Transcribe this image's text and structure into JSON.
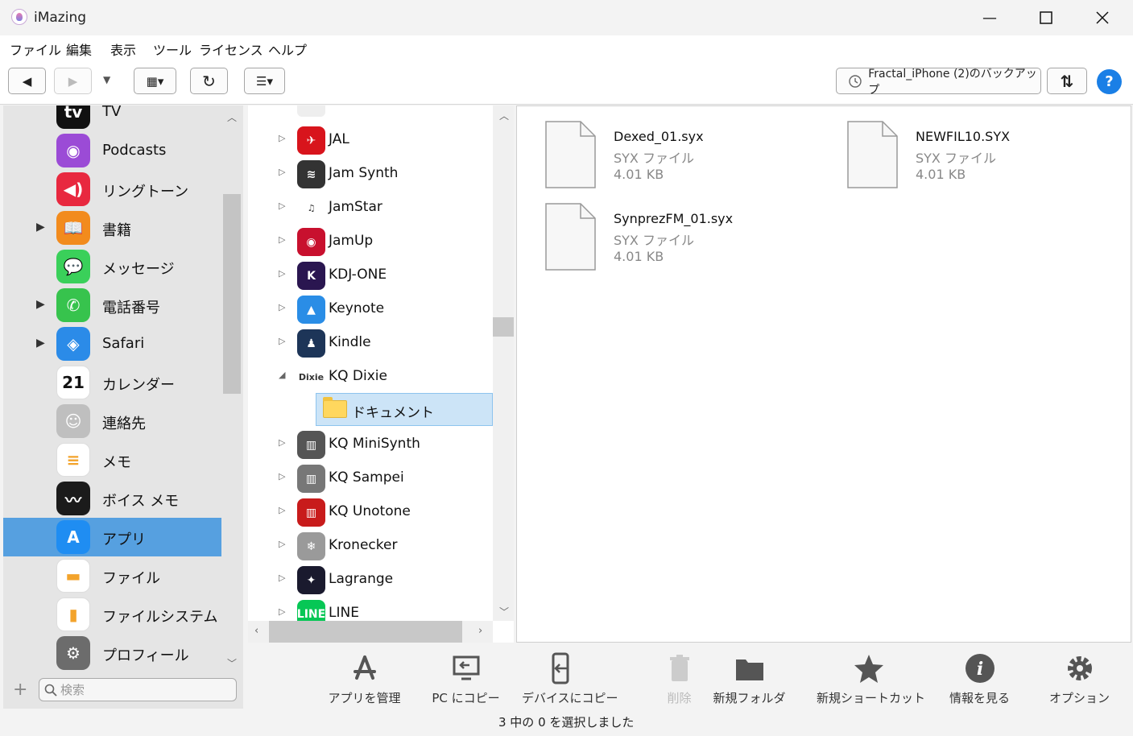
{
  "window": {
    "title": "iMazing",
    "minimize": "—",
    "maximize": "☐",
    "close": "✕"
  },
  "menu": [
    "ファイル",
    "編集",
    "表示",
    "ツール",
    "ライセンス",
    "ヘルプ"
  ],
  "toolbar": {
    "back": "◀",
    "forward": "▶",
    "dropdown": "▼",
    "view": "▦▾",
    "refresh": "↻",
    "list": "☰▾",
    "backup_label": "Fractal_iPhone (2)のバックアップ",
    "help": "?",
    "transfer": "⇅"
  },
  "sidebar": {
    "items": [
      {
        "label": "TV",
        "icon": "tv-icon",
        "color": "#111111",
        "glyph": "tv",
        "arrow": ""
      },
      {
        "label": "Podcasts",
        "icon": "podcasts-icon",
        "color": "#9b4bd6",
        "glyph": "◉",
        "arrow": ""
      },
      {
        "label": "リングトーン",
        "icon": "ringtone-icon",
        "color": "#e8283f",
        "glyph": "◀)",
        "arrow": ""
      },
      {
        "label": "書籍",
        "icon": "books-icon",
        "color": "#f28b1d",
        "glyph": "📖",
        "arrow": "▶"
      },
      {
        "label": "メッセージ",
        "icon": "messages-icon",
        "color": "#3ad05a",
        "glyph": "💬",
        "arrow": ""
      },
      {
        "label": "電話番号",
        "icon": "phone-icon",
        "color": "#37c34d",
        "glyph": "✆",
        "arrow": "▶"
      },
      {
        "label": "Safari",
        "icon": "safari-icon",
        "color": "#2b8be8",
        "glyph": "◈",
        "arrow": "▶"
      },
      {
        "label": "カレンダー",
        "icon": "calendar-icon",
        "color": "#ffffff",
        "glyph": "21",
        "arrow": ""
      },
      {
        "label": "連絡先",
        "icon": "contacts-icon",
        "color": "#bfbfbf",
        "glyph": "☺",
        "arrow": ""
      },
      {
        "label": "メモ",
        "icon": "notes-icon",
        "color": "#ffffff",
        "glyph": "≡",
        "arrow": ""
      },
      {
        "label": "ボイス メモ",
        "icon": "voice-memo-icon",
        "color": "#1b1b1b",
        "glyph": "〰",
        "arrow": ""
      },
      {
        "label": "アプリ",
        "icon": "appstore-icon",
        "color": "#1f8df2",
        "glyph": "A",
        "arrow": ""
      },
      {
        "label": "ファイル",
        "icon": "files-icon",
        "color": "#ffffff",
        "glyph": "▬",
        "arrow": ""
      },
      {
        "label": "ファイルシステム",
        "icon": "filesystem-icon",
        "color": "#ffffff",
        "glyph": "▮",
        "arrow": ""
      },
      {
        "label": "プロフィール",
        "icon": "profile-icon",
        "color": "#6c6c6c",
        "glyph": "⚙",
        "arrow": ""
      }
    ],
    "selected": "アプリ",
    "search_placeholder": "検索",
    "add": "+"
  },
  "tree": {
    "items": [
      {
        "label": "JAL",
        "color": "#d8141c",
        "glyph": "✈"
      },
      {
        "label": "Jam Synth",
        "color": "#333333",
        "glyph": "≋"
      },
      {
        "label": "JamStar",
        "color": "#ffffff",
        "glyph": "♫"
      },
      {
        "label": "JamUp",
        "color": "#c8102e",
        "glyph": "◉"
      },
      {
        "label": "KDJ-ONE",
        "color": "#2a1650",
        "glyph": "K"
      },
      {
        "label": "Keynote",
        "color": "#2a8de6",
        "glyph": "▲"
      },
      {
        "label": "Kindle",
        "color": "#1d3558",
        "glyph": "♟"
      },
      {
        "label": "KQ Dixie",
        "color": "#ffffff",
        "glyph": "Dixie"
      },
      {
        "label": "KQ MiniSynth",
        "color": "#555555",
        "glyph": "▥"
      },
      {
        "label": "KQ Sampei",
        "color": "#777777",
        "glyph": "▥"
      },
      {
        "label": "KQ Unotone",
        "color": "#c81b1b",
        "glyph": "▥"
      },
      {
        "label": "Kronecker",
        "color": "#9a9a9a",
        "glyph": "❄"
      },
      {
        "label": "Lagrange",
        "color": "#1a1a2e",
        "glyph": "✦"
      },
      {
        "label": "LINE",
        "color": "#06c755",
        "glyph": "LINE"
      }
    ],
    "expanded": "KQ Dixie",
    "child_label": "ドキュメント"
  },
  "files": [
    {
      "name": "Dexed_01.syx",
      "type": "SYX ファイル",
      "size": "4.01 KB"
    },
    {
      "name": "NEWFIL10.SYX",
      "type": "SYX ファイル",
      "size": "4.01 KB"
    },
    {
      "name": "SynprezFM_01.syx",
      "type": "SYX ファイル",
      "size": "4.01 KB"
    }
  ],
  "actions": [
    {
      "label": "アプリを管理",
      "icon": "manage-apps-icon",
      "disabled": false
    },
    {
      "label": "PC にコピー",
      "icon": "copy-to-pc-icon",
      "disabled": false
    },
    {
      "label": "デバイスにコピー",
      "icon": "copy-to-device-icon",
      "disabled": false
    },
    {
      "label": "削除",
      "icon": "delete-icon",
      "disabled": true
    },
    {
      "label": "新規フォルダ",
      "icon": "new-folder-icon",
      "disabled": false
    },
    {
      "label": "新規ショートカット",
      "icon": "new-shortcut-icon",
      "disabled": false
    },
    {
      "label": "情報を見る",
      "icon": "info-icon",
      "disabled": false
    },
    {
      "label": "オプション",
      "icon": "options-icon",
      "disabled": false
    }
  ],
  "status": "3 中の 0 を選択しました"
}
